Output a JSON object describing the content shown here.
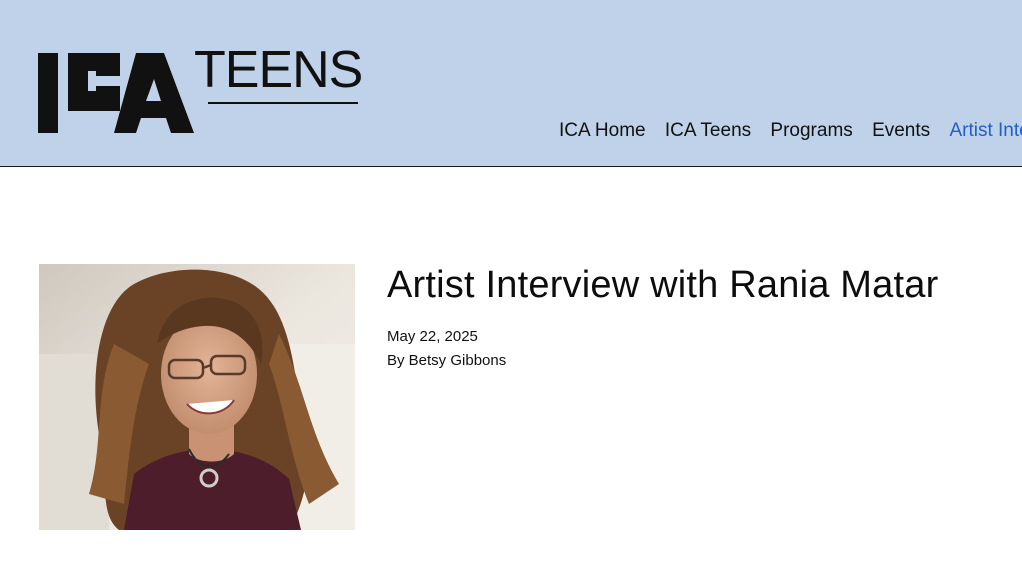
{
  "header": {
    "logo": {
      "wordmark": "ICA",
      "subbrand": "TEENS"
    },
    "nav": [
      {
        "label": "ICA Home",
        "active": false
      },
      {
        "label": "ICA Teens",
        "active": false
      },
      {
        "label": "Programs",
        "active": false
      },
      {
        "label": "Events",
        "active": false
      },
      {
        "label": "Artist Interviews",
        "active": true
      }
    ],
    "background_color": "#bfd2ea",
    "active_color": "#1f5fc7"
  },
  "article": {
    "title": "Artist Interview with Rania Matar",
    "date": "May 22, 2025",
    "byline": "By Betsy Gibbons",
    "photo_alt": "Portrait of Rania Matar"
  }
}
